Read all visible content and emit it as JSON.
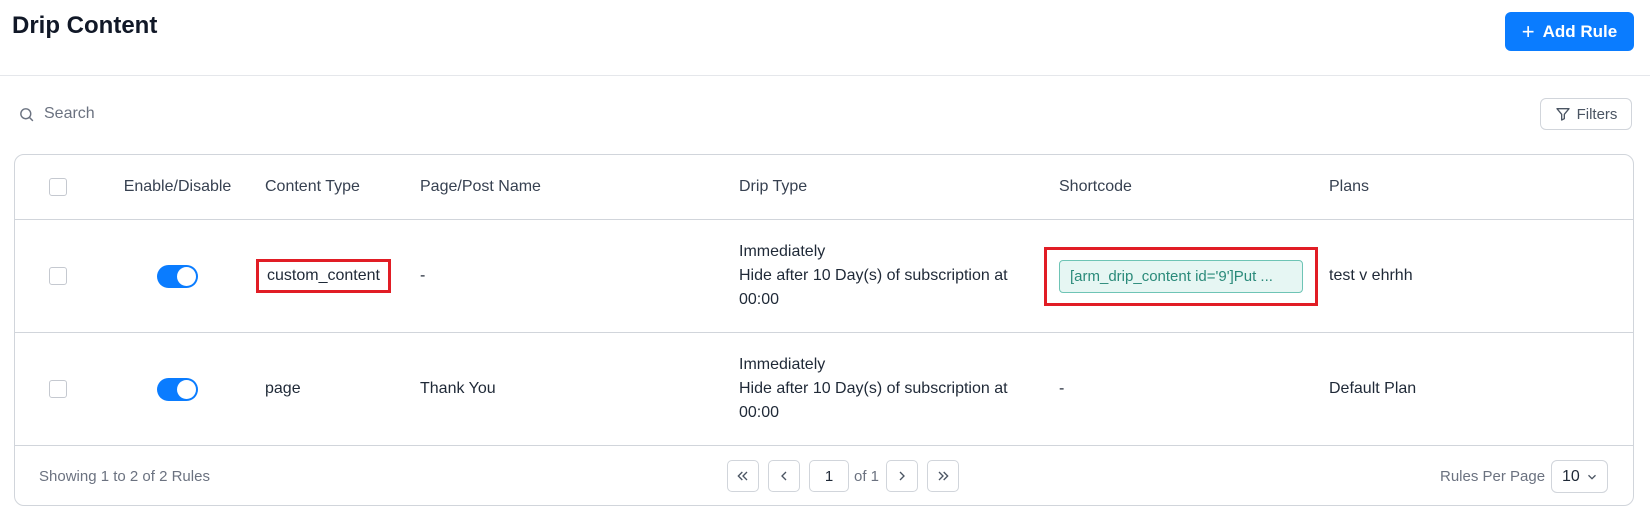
{
  "header": {
    "title": "Drip Content",
    "add_rule_label": "Add Rule"
  },
  "search": {
    "placeholder": "Search",
    "value": ""
  },
  "filters_label": "Filters",
  "table": {
    "columns": [
      "Enable/Disable",
      "Content Type",
      "Page/Post Name",
      "Drip Type",
      "Shortcode",
      "Plans"
    ],
    "rows": [
      {
        "enabled": true,
        "content_type": "custom_content",
        "page_name": "-",
        "drip_type_line1": "Immediately",
        "drip_type_line2": "Hide after 10 Day(s) of subscription at 00:00",
        "shortcode": "[arm_drip_content id='9']Put ...",
        "plans": "test v ehrhh"
      },
      {
        "enabled": true,
        "content_type": "page",
        "page_name": "Thank You",
        "drip_type_line1": "Immediately",
        "drip_type_line2": "Hide after 10 Day(s) of subscription at 00:00",
        "shortcode": "-",
        "plans": "Default Plan"
      }
    ]
  },
  "footer": {
    "showing": "Showing 1 to 2 of 2 Rules",
    "current_page": "1",
    "of_pages": "of 1",
    "rules_per_page_label": "Rules Per Page",
    "rules_per_page_value": "10"
  },
  "colors": {
    "primary": "#0a7cff",
    "highlight": "#e11d25",
    "shortcode_bg": "#e6f6f3",
    "shortcode_text": "#2a8a7a"
  }
}
